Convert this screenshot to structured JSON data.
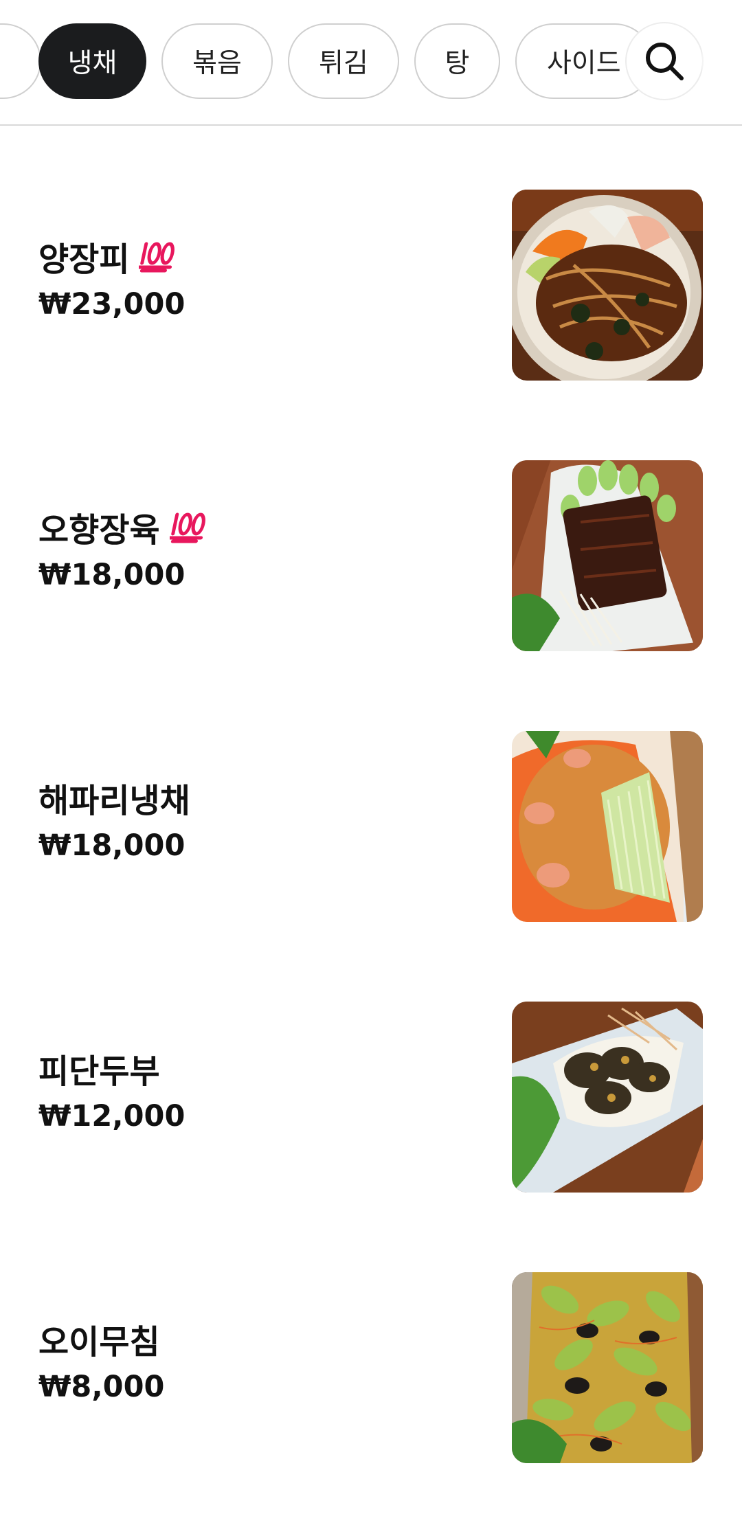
{
  "category_tabs": {
    "prev_label": "",
    "items": [
      {
        "label": "냉채",
        "active": true
      },
      {
        "label": "볶음",
        "active": false
      },
      {
        "label": "튀김",
        "active": false
      },
      {
        "label": "탕",
        "active": false
      },
      {
        "label": "사이드",
        "active": false
      }
    ],
    "search_icon": "search-icon"
  },
  "menu": {
    "currency_symbol": "₩",
    "badge_icon": "hundred-points-icon",
    "badge_color": "#e8175d",
    "items": [
      {
        "name": "양장피",
        "price": "₩23,000",
        "badge": true,
        "image": "yangjangpi-photo"
      },
      {
        "name": "오향장육",
        "price": "₩18,000",
        "badge": true,
        "image": "ohyang-jangyuk-photo"
      },
      {
        "name": "해파리냉채",
        "price": "₩18,000",
        "badge": false,
        "image": "jellyfish-salad-photo"
      },
      {
        "name": "피단두부",
        "price": "₩12,000",
        "badge": false,
        "image": "century-egg-tofu-photo"
      },
      {
        "name": "오이무침",
        "price": "₩8,000",
        "badge": false,
        "image": "cucumber-salad-photo"
      }
    ]
  },
  "colors": {
    "active_tab_bg": "#1b1c1e",
    "tab_border": "#cfcfcf",
    "text": "#111111"
  }
}
